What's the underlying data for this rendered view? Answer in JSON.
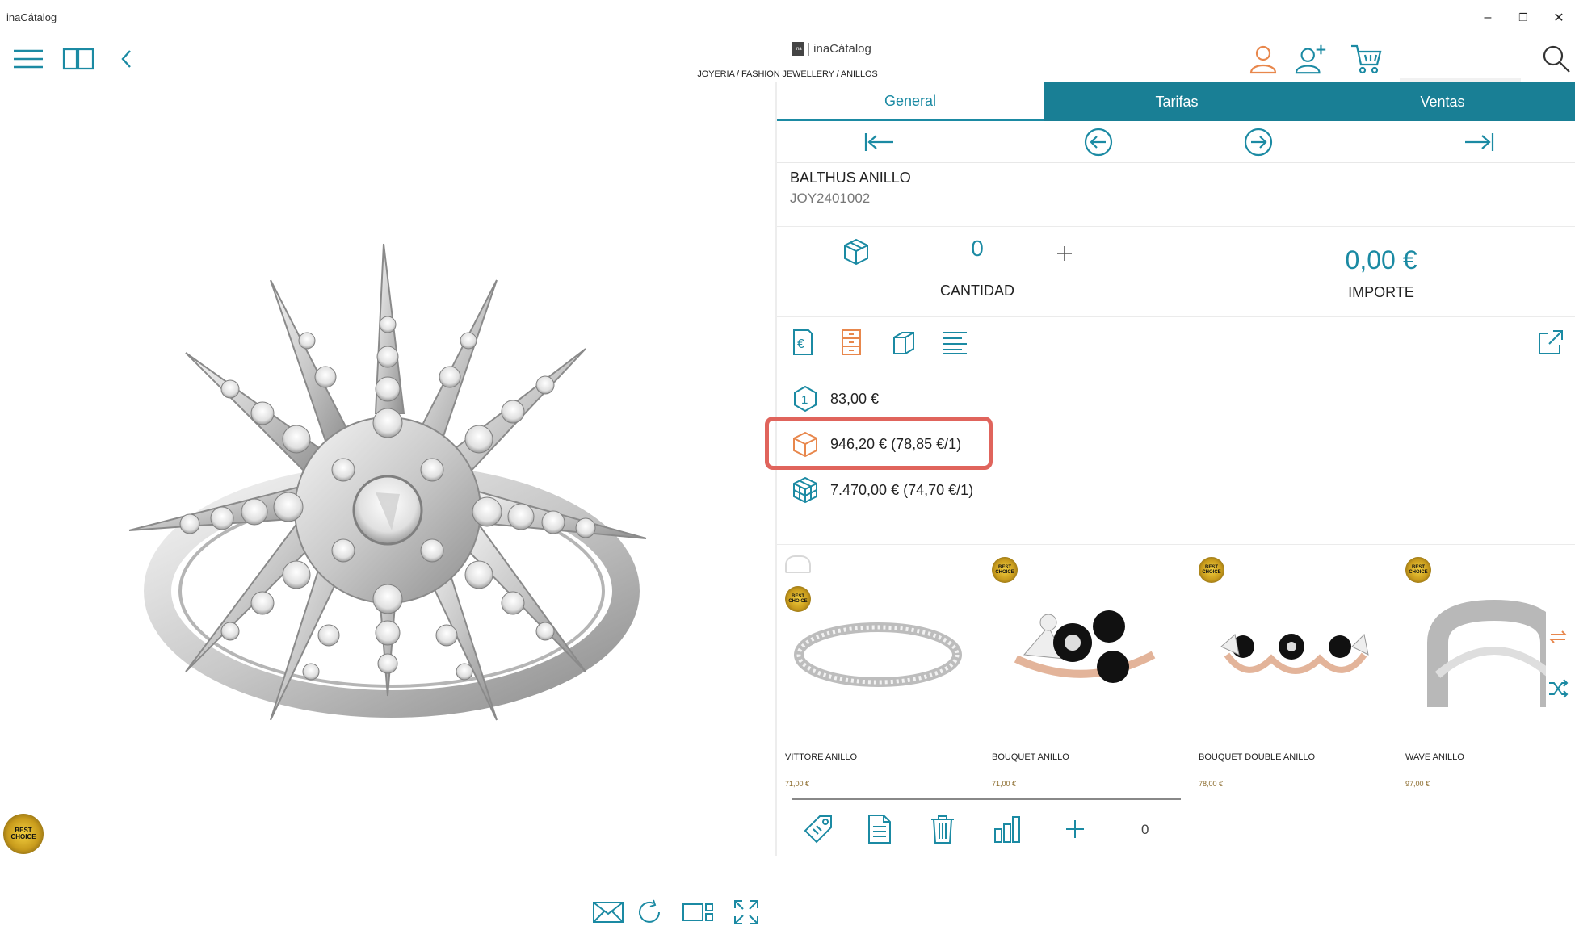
{
  "window": {
    "title": "inaCátalog",
    "minimize": "–",
    "restore": "❐",
    "close": "✕"
  },
  "header": {
    "brand": "inaCátalog",
    "brand_logo": "ina",
    "breadcrumb": "JOYERIA / FASHION JEWELLERY / ANILLOS",
    "search": {
      "value": "",
      "placeholder": ""
    }
  },
  "left_panel": {
    "best_choice_badge": "BEST CHOICE",
    "product_image": "silver starburst crystal ring"
  },
  "tabs": [
    {
      "label": "General",
      "active": true
    },
    {
      "label": "Tarifas",
      "active": false
    },
    {
      "label": "Ventas",
      "active": false
    }
  ],
  "product": {
    "name": "BALTHUS ANILLO",
    "code": "JOY2401002"
  },
  "quantity": {
    "value": "0",
    "label": "CANTIDAD"
  },
  "amount": {
    "value": "0,00 €",
    "label": "IMPORTE"
  },
  "prices": [
    {
      "icon": "unit-1-icon",
      "text": "83,00 €"
    },
    {
      "icon": "box-icon",
      "text": "946,20 € (78,85 €/1)",
      "highlighted": true
    },
    {
      "icon": "pallet-icon",
      "text": "7.470,00 € (74,70 €/1)"
    }
  ],
  "related": [
    {
      "name": "VITTORE ANILLO",
      "price": "71,00 €",
      "badge": "BEST CHOICE"
    },
    {
      "name": "BOUQUET ANILLO",
      "price": "71,00 €",
      "badge": "BEST CHOICE"
    },
    {
      "name": "BOUQUET DOUBLE ANILLO",
      "price": "78,00 €",
      "badge": "BEST CHOICE"
    },
    {
      "name": "WAVE ANILLO",
      "price": "97,00 €",
      "badge": "BEST CHOICE"
    }
  ],
  "bottom_bar": {
    "add_count": "0"
  },
  "colors": {
    "accent": "#1b8aa3",
    "tab_bg": "#197f95",
    "orange": "#e8874c",
    "highlight": "#e0645c"
  }
}
